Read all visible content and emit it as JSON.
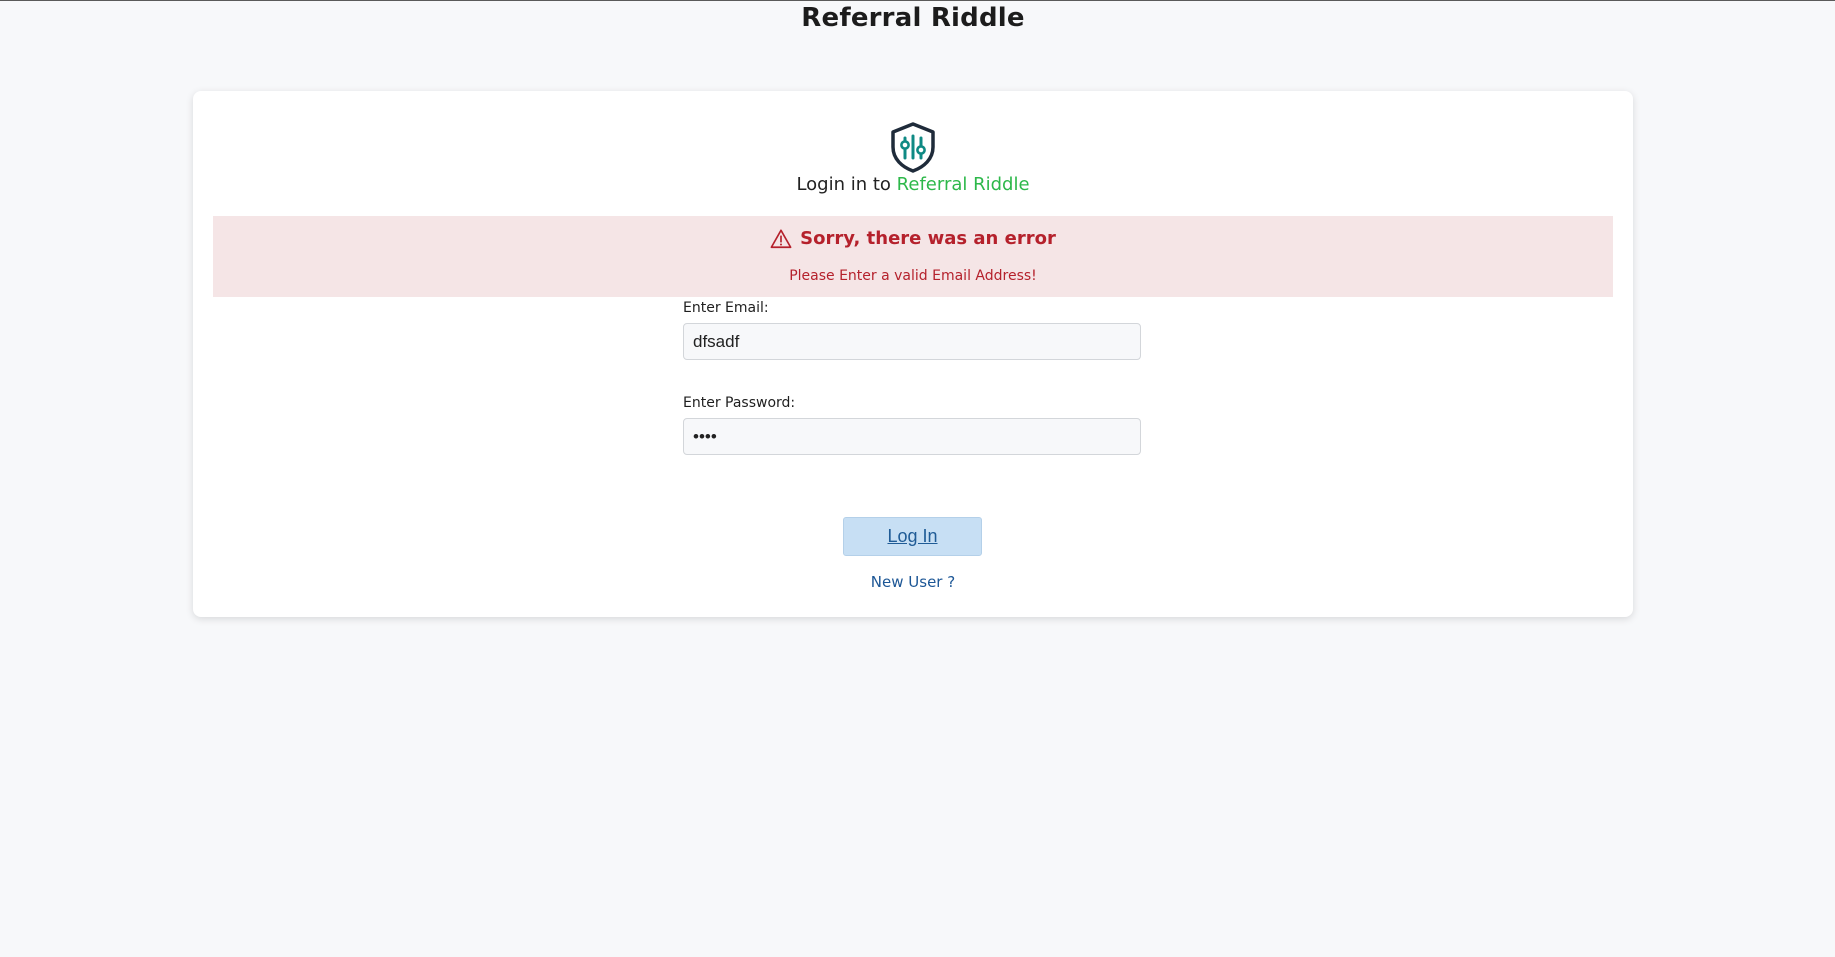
{
  "app": {
    "title": "Referral Riddle"
  },
  "login_card": {
    "heading_prefix": "Login in to ",
    "heading_brand": "Referral Riddle",
    "logo_icon": "shield-sliders-icon"
  },
  "alert": {
    "icon": "warning-triangle-icon",
    "title": "Sorry, there was an error",
    "message": "Please Enter a valid Email Address!"
  },
  "form": {
    "email": {
      "label": "Enter Email:",
      "value": "dfsadf"
    },
    "password": {
      "label": "Enter Password:",
      "value": "1234"
    },
    "login_button": "Log In",
    "new_user_link": "New User ?"
  },
  "colors": {
    "brand_green": "#2db84a",
    "error_red": "#b5212c",
    "alert_bg": "#f5e5e6",
    "button_bg": "#c7dff4",
    "link_blue": "#1d5796",
    "logo_teal": "#0f8a84"
  }
}
